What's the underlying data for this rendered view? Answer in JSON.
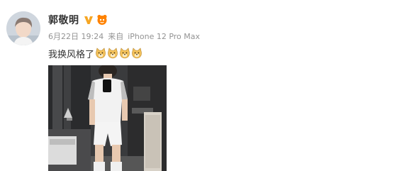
{
  "post": {
    "username": "郭敬明",
    "date": "6月22日 19:24",
    "source_prefix": "来自",
    "source": "iPhone 12 Pro Max",
    "text": "我换风格了",
    "emoji_count": 4
  },
  "icons": {
    "avatar": "avatar-photo",
    "verified": "verified-v-badge-icon",
    "level": "member-level-icon",
    "emoji": "doge-emoji-icon"
  },
  "colors": {
    "username": "#333333",
    "meta": "#939393",
    "verified": "#f6a623"
  }
}
